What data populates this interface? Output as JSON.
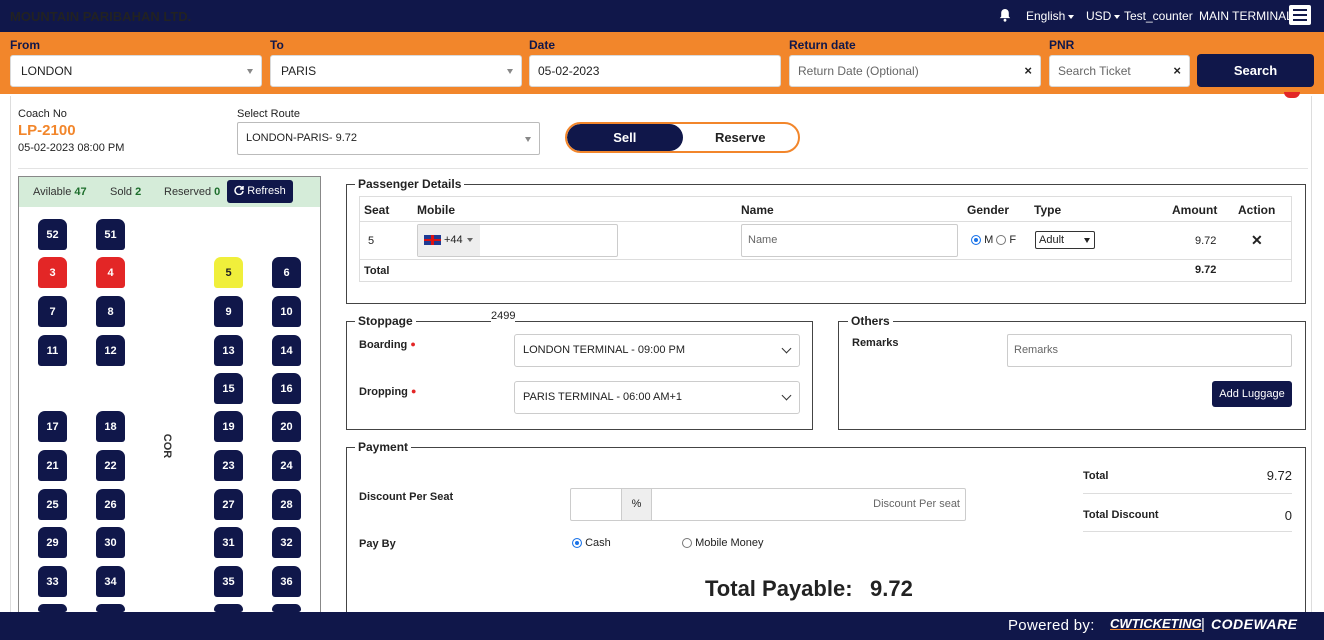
{
  "header": {
    "brand": "MOUNTAIN PARIBAHAN LTD.",
    "language": "English",
    "currency": "USD",
    "user": "Test_counter",
    "terminal": "MAIN TERMINAL"
  },
  "search": {
    "from_label": "From",
    "from_value": "LONDON",
    "to_label": "To",
    "to_value": "PARIS",
    "date_label": "Date",
    "date_value": "05-02-2023",
    "return_label": "Return date",
    "return_placeholder": "Return Date (Optional)",
    "pnr_label": "PNR",
    "pnr_placeholder": "Search Ticket",
    "search_button": "Search"
  },
  "coach": {
    "no_label": "Coach No",
    "code": "LP-2100",
    "datetime": "05-02-2023 08:00 PM",
    "route_label": "Select Route",
    "route_value": "LONDON-PARIS- 9.72",
    "sell_label": "Sell",
    "reserve_label": "Reserve"
  },
  "seatmap": {
    "available_label": "Avilable",
    "available_count": "47",
    "sold_label": "Sold",
    "sold_count": "2",
    "reserved_label": "Reserved",
    "reserved_count": "0",
    "refresh_label": "Refresh",
    "corridor_label": "COR",
    "seats": [
      {
        "no": "52",
        "status": "available"
      },
      {
        "no": "51",
        "status": "available"
      },
      {
        "no": "3",
        "status": "sold"
      },
      {
        "no": "4",
        "status": "sold"
      },
      {
        "no": "5",
        "status": "selected"
      },
      {
        "no": "6",
        "status": "available"
      },
      {
        "no": "7",
        "status": "available"
      },
      {
        "no": "8",
        "status": "available"
      },
      {
        "no": "9",
        "status": "available"
      },
      {
        "no": "10",
        "status": "available"
      },
      {
        "no": "11",
        "status": "available"
      },
      {
        "no": "12",
        "status": "available"
      },
      {
        "no": "13",
        "status": "available"
      },
      {
        "no": "14",
        "status": "available"
      },
      {
        "no": "15",
        "status": "available"
      },
      {
        "no": "16",
        "status": "available"
      },
      {
        "no": "17",
        "status": "available"
      },
      {
        "no": "18",
        "status": "available"
      },
      {
        "no": "19",
        "status": "available"
      },
      {
        "no": "20",
        "status": "available"
      },
      {
        "no": "21",
        "status": "available"
      },
      {
        "no": "22",
        "status": "available"
      },
      {
        "no": "23",
        "status": "available"
      },
      {
        "no": "24",
        "status": "available"
      },
      {
        "no": "25",
        "status": "available"
      },
      {
        "no": "26",
        "status": "available"
      },
      {
        "no": "27",
        "status": "available"
      },
      {
        "no": "28",
        "status": "available"
      },
      {
        "no": "29",
        "status": "available"
      },
      {
        "no": "30",
        "status": "available"
      },
      {
        "no": "31",
        "status": "available"
      },
      {
        "no": "32",
        "status": "available"
      },
      {
        "no": "33",
        "status": "available"
      },
      {
        "no": "34",
        "status": "available"
      },
      {
        "no": "35",
        "status": "available"
      },
      {
        "no": "36",
        "status": "available"
      }
    ]
  },
  "passenger": {
    "legend": "Passenger Details",
    "headers": {
      "seat": "Seat",
      "mobile": "Mobile",
      "name": "Name",
      "gender": "Gender",
      "type": "Type",
      "amount": "Amount",
      "action": "Action"
    },
    "row": {
      "seat": "5",
      "dial_code": "+44",
      "name_placeholder": "Name",
      "gender_m": "M",
      "gender_f": "F",
      "type": "Adult",
      "amount": "9.72"
    },
    "total_label": "Total",
    "total_amount": "9.72"
  },
  "stoppage": {
    "legend": "Stoppage",
    "code": "2499",
    "boarding_label": "Boarding",
    "boarding_value": "LONDON TERMINAL - 09:00 PM",
    "dropping_label": "Dropping",
    "dropping_value": "PARIS TERMINAL - 06:00 AM+1"
  },
  "others": {
    "legend": "Others",
    "remarks_label": "Remarks",
    "remarks_placeholder": "Remarks",
    "add_luggage": "Add Luggage"
  },
  "payment": {
    "legend": "Payment",
    "discount_label": "Discount Per Seat",
    "percent": "%",
    "discount_placeholder": "Discount Per seat",
    "pay_by_label": "Pay By",
    "cash_label": "Cash",
    "mobile_money_label": "Mobile Money",
    "total_label": "Total",
    "total_value": "9.72",
    "total_discount_label": "Total Discount",
    "total_discount_value": "0",
    "payable_label": "Total Payable:",
    "payable_value": "9.72"
  },
  "footer": {
    "powered_by": "Powered by:",
    "logo1": "CWTICKETING",
    "separator": "|",
    "logo2": "CODEWARE"
  }
}
